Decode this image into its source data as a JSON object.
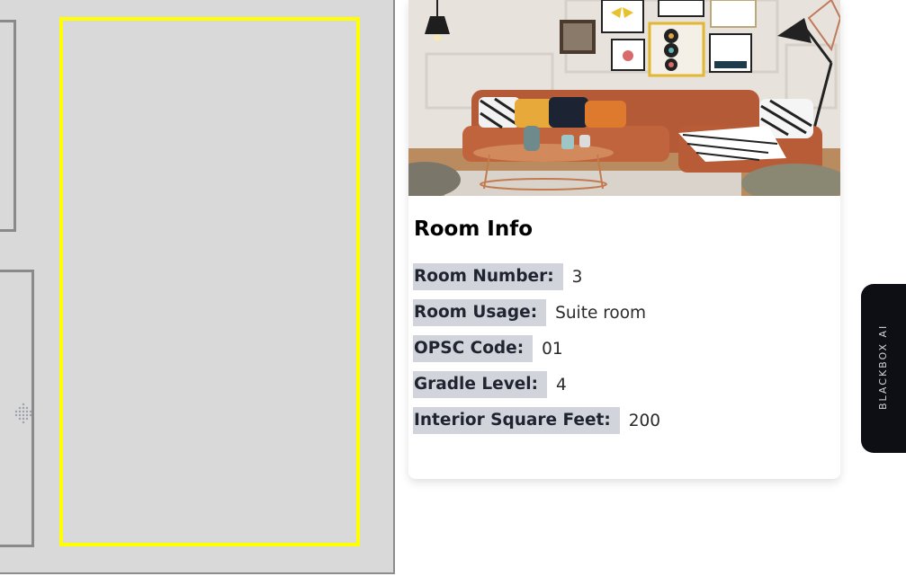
{
  "card": {
    "title": "Room Info",
    "fields": [
      {
        "label": "Room Number:",
        "value": "3"
      },
      {
        "label": "Room Usage:",
        "value": "Suite room"
      },
      {
        "label": "OPSC Code:",
        "value": "01"
      },
      {
        "label": "Gradle Level:",
        "value": "4"
      },
      {
        "label": "Interior Square Feet:",
        "value": "200"
      }
    ]
  },
  "side_tab": {
    "label": "BLACKBOX AI",
    "icon": "dots-logo-icon"
  },
  "colors": {
    "plan_background": "#d9d9d9",
    "room_outline": "#8a8a8a",
    "selected_room": "#ffff00",
    "label_background": "#d1d5db",
    "side_tab_background": "#0d0f14"
  }
}
